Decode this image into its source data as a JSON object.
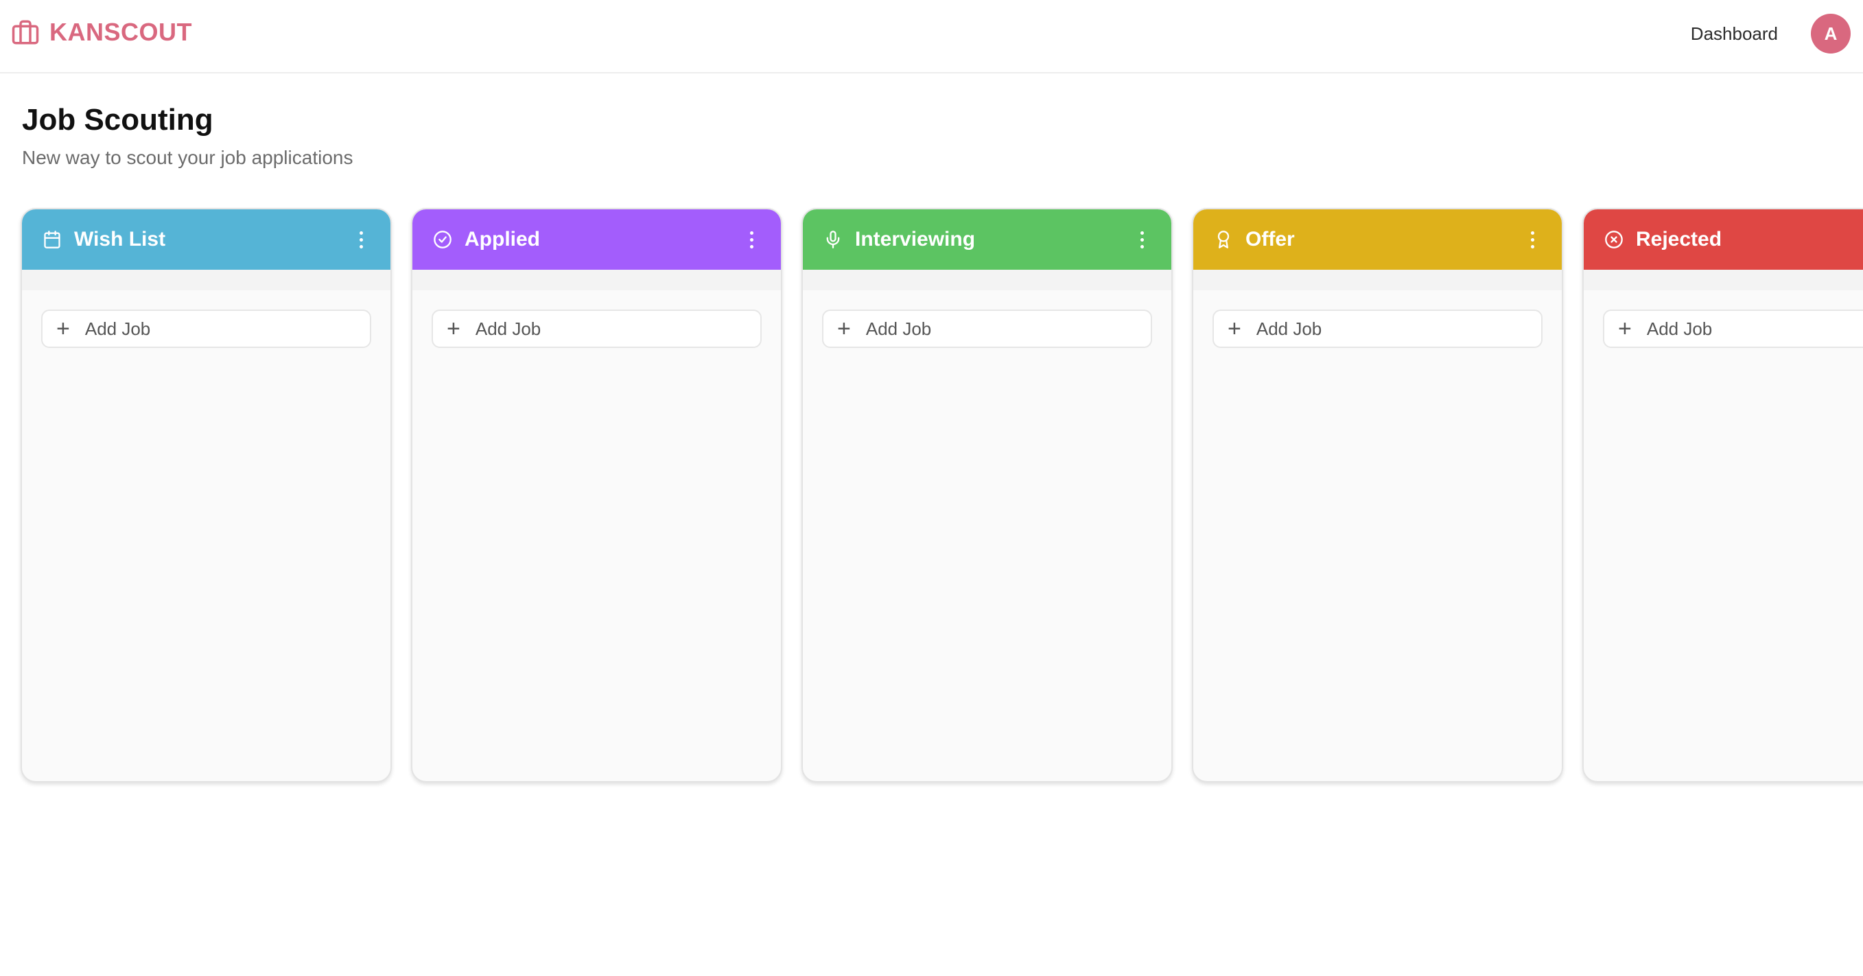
{
  "app": {
    "brand": "KANSCOUT",
    "brand_icon": "briefcase-icon",
    "brand_color": "#d9687f"
  },
  "nav": {
    "dashboard_label": "Dashboard",
    "avatar_initial": "A"
  },
  "page": {
    "title": "Job Scouting",
    "subtitle": "New way to scout your job applications"
  },
  "columns": [
    {
      "title": "Wish List",
      "icon": "calendar-icon",
      "color": "#55b4d6",
      "add_label": "Add Job"
    },
    {
      "title": "Applied",
      "icon": "check-circle-icon",
      "color": "#a35dfc",
      "add_label": "Add Job"
    },
    {
      "title": "Interviewing",
      "icon": "microphone-icon",
      "color": "#5cc462",
      "add_label": "Add Job"
    },
    {
      "title": "Offer",
      "icon": "award-icon",
      "color": "#deb11b",
      "add_label": "Add Job"
    },
    {
      "title": "Rejected",
      "icon": "x-circle-icon",
      "color": "#df4744",
      "add_label": "Add Job"
    }
  ]
}
